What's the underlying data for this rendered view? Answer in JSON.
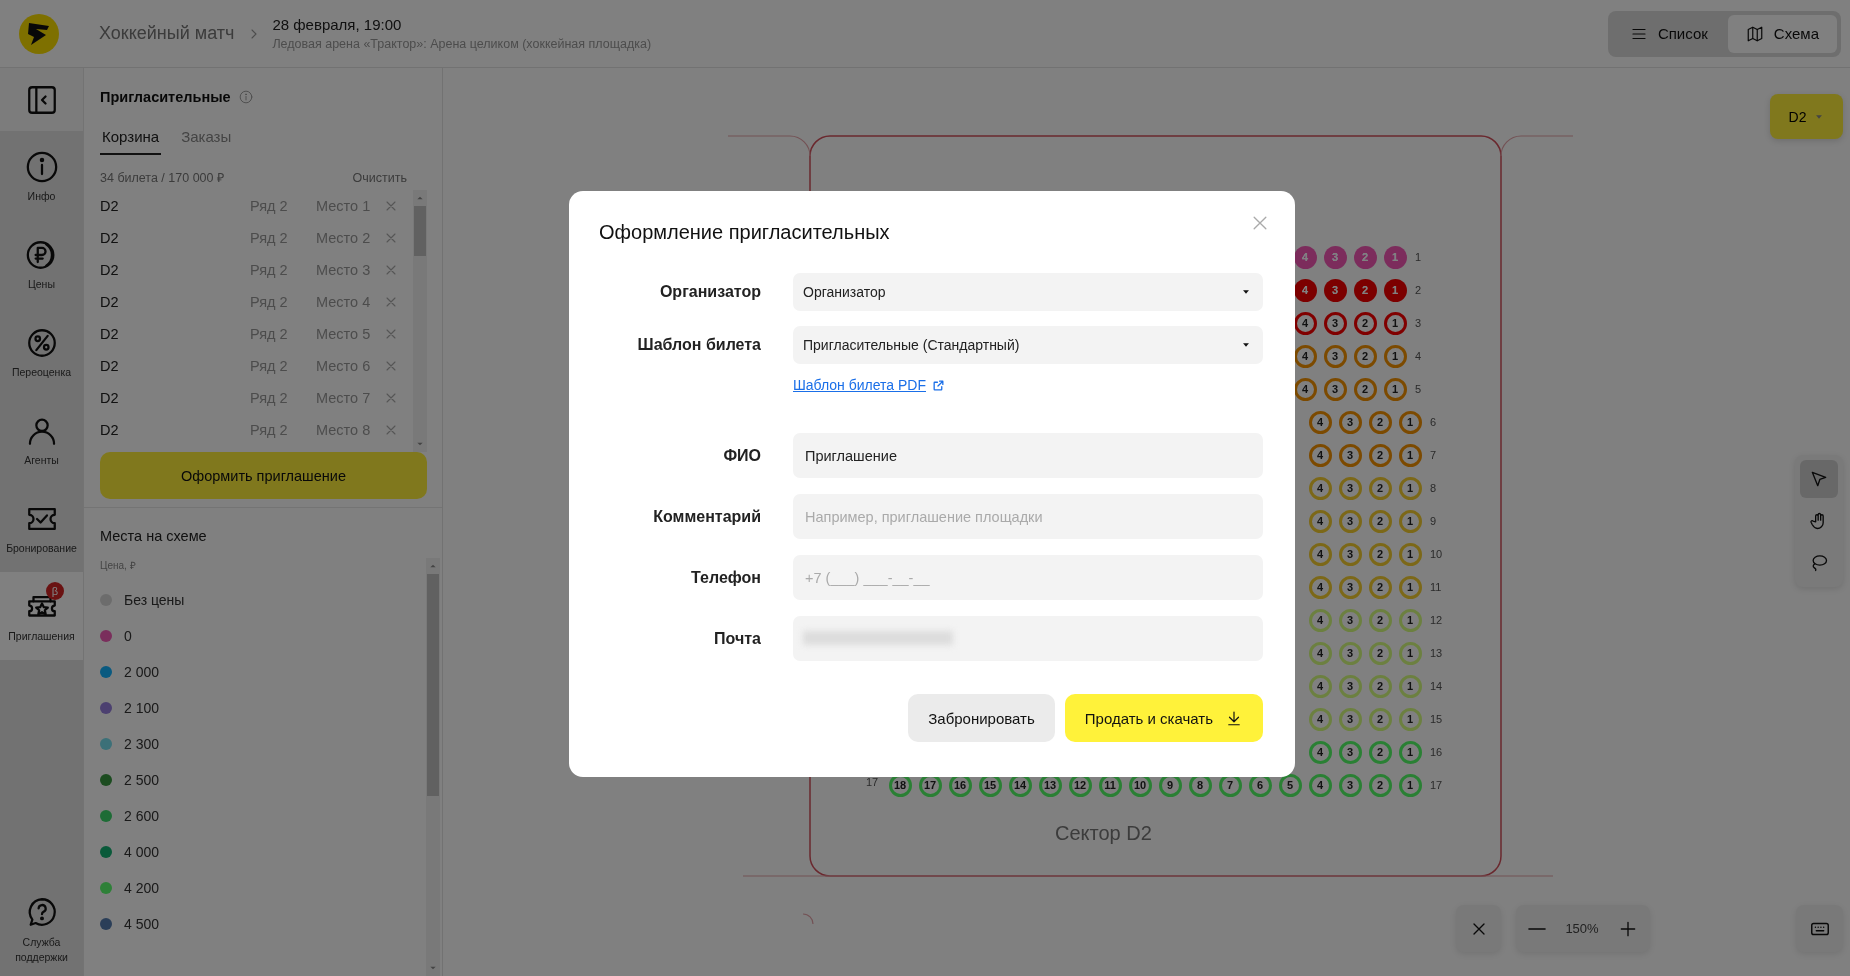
{
  "header": {
    "title": "Хоккейный матч",
    "date": "28 февраля, 19:00",
    "venue": "Ледовая арена «Трактор»: Арена целиком (хоккейная площадка)",
    "view_toggle": [
      {
        "kind": "list",
        "label": "Список",
        "selected": false
      },
      {
        "kind": "map",
        "label": "Схема",
        "selected": true
      }
    ]
  },
  "rail": {
    "items": [
      {
        "kind": "info",
        "label": "Инфо",
        "selected": false
      },
      {
        "kind": "prices",
        "label": "Цены",
        "selected": false
      },
      {
        "kind": "discount",
        "label": "Переоценка",
        "selected": false
      },
      {
        "kind": "agents",
        "label": "Агенты",
        "selected": false
      },
      {
        "kind": "booking",
        "label": "Бронирование",
        "selected": false
      },
      {
        "kind": "invites",
        "label": "Приглашения",
        "selected": true,
        "badge": "β"
      }
    ],
    "support": {
      "label": "Служба поддержки"
    }
  },
  "cart": {
    "title": "Пригласительные",
    "tabs": [
      {
        "label": "Корзина",
        "selected": true
      },
      {
        "label": "Заказы",
        "selected": false
      }
    ],
    "summary": "34 билета / 170 000 ₽",
    "clear": "Очистить",
    "items": [
      {
        "sector": "D2",
        "row": "Ряд 2",
        "seat": "Место 1"
      },
      {
        "sector": "D2",
        "row": "Ряд 2",
        "seat": "Место 2"
      },
      {
        "sector": "D2",
        "row": "Ряд 2",
        "seat": "Место 3"
      },
      {
        "sector": "D2",
        "row": "Ряд 2",
        "seat": "Место 4"
      },
      {
        "sector": "D2",
        "row": "Ряд 2",
        "seat": "Место 5"
      },
      {
        "sector": "D2",
        "row": "Ряд 2",
        "seat": "Место 6"
      },
      {
        "sector": "D2",
        "row": "Ряд 2",
        "seat": "Место 7"
      },
      {
        "sector": "D2",
        "row": "Ряд 2",
        "seat": "Место 8"
      }
    ],
    "button": "Оформить приглашение"
  },
  "legend": {
    "title": "Места на схеме",
    "caption": "Цена, ₽",
    "items": [
      {
        "label": "Без цены",
        "color": "#6c6c6c"
      },
      {
        "label": "0",
        "color": "#7a2e5c"
      },
      {
        "label": "2 000",
        "color": "#0a5a8a"
      },
      {
        "label": "2 100",
        "color": "#4c4070"
      },
      {
        "label": "2 300",
        "color": "#3c7078"
      },
      {
        "label": "2 500",
        "color": "#1c4c20"
      },
      {
        "label": "2 600",
        "color": "#1e6c36"
      },
      {
        "label": "4 000",
        "color": "#0a5a3a"
      },
      {
        "label": "4 200",
        "color": "#2e8038"
      },
      {
        "label": "4 500",
        "color": "#2a3e58"
      }
    ]
  },
  "seat_map": {
    "sector": "Сектор D2",
    "rows": [
      {
        "label": "1",
        "color": "#7c2c5c",
        "filled": true,
        "seats": [
          "4",
          "3",
          "2",
          "1"
        ]
      },
      {
        "label": "2",
        "color": "#7c0000",
        "filled": true,
        "seats": [
          "4",
          "3",
          "2",
          "1"
        ]
      },
      {
        "label": "3",
        "color": "#8c0000",
        "filled": false,
        "seats": [
          "4",
          "3",
          "2",
          "1"
        ]
      },
      {
        "label": "4",
        "color": "#7c4a00",
        "filled": false,
        "seats": [
          "4",
          "3",
          "2",
          "1"
        ]
      },
      {
        "label": "5",
        "color": "#7c4a00",
        "filled": false,
        "seats": [
          "4",
          "3",
          "2",
          "1"
        ]
      },
      {
        "label": "6",
        "color": "#7c4a00",
        "filled": false,
        "seats": [
          "4",
          "3",
          "2",
          "1"
        ]
      },
      {
        "label": "7",
        "color": "#7c4a00",
        "filled": false,
        "seats": [
          "4",
          "3",
          "2",
          "1"
        ]
      },
      {
        "label": "8",
        "color": "#7c6818",
        "filled": false,
        "seats": [
          "4",
          "3",
          "2",
          "1"
        ]
      },
      {
        "label": "9",
        "color": "#7c6818",
        "filled": false,
        "seats": [
          "4",
          "3",
          "2",
          "1"
        ]
      },
      {
        "label": "10",
        "color": "#7c6818",
        "filled": false,
        "seats": [
          "4",
          "3",
          "2",
          "1"
        ]
      },
      {
        "label": "11",
        "color": "#7c6818",
        "filled": false,
        "seats": [
          "4",
          "3",
          "2",
          "1"
        ]
      },
      {
        "label": "12",
        "color": "#6c8c40",
        "filled": false,
        "seats": [
          "4",
          "3",
          "2",
          "1"
        ]
      },
      {
        "label": "13",
        "color": "#6c8c40",
        "filled": false,
        "seats": [
          "4",
          "3",
          "2",
          "1"
        ]
      },
      {
        "label": "14",
        "color": "#6c8c40",
        "filled": false,
        "seats": [
          "4",
          "3",
          "2",
          "1"
        ]
      },
      {
        "label": "15",
        "color": "#6c8c40",
        "filled": false,
        "seats": [
          "4",
          "3",
          "2",
          "1"
        ]
      },
      {
        "label": "16",
        "color": "#2a8a34",
        "filled": false,
        "seats": [
          "4",
          "3",
          "2",
          "1"
        ]
      },
      {
        "label": "17",
        "left_label": "17",
        "color": "#2a8a34",
        "filled": false,
        "seats": [
          "18",
          "17",
          "16",
          "15",
          "14",
          "13",
          "12",
          "11",
          "10",
          "9",
          "8",
          "7",
          "6",
          "5",
          "4",
          "3",
          "2",
          "1"
        ]
      }
    ]
  },
  "map_controls": {
    "sector_select": "D2",
    "tools": [
      {
        "kind": "pointer",
        "selected": true
      },
      {
        "kind": "hand",
        "selected": false
      },
      {
        "kind": "lasso",
        "selected": false
      }
    ],
    "zoom": "150%"
  },
  "modal": {
    "title": "Оформление пригласительных",
    "fields": [
      {
        "kind": "select",
        "label": "Организатор",
        "value": "Организатор"
      },
      {
        "kind": "select",
        "label": "Шаблон билета",
        "value": "Пригласительные (Стандартный)",
        "link": "Шаблон билета PDF"
      },
      {
        "kind": "text",
        "label": "ФИО",
        "value": "Приглашение"
      },
      {
        "kind": "text",
        "label": "Комментарий",
        "placeholder": "Например, приглашение площадки"
      },
      {
        "kind": "text",
        "label": "Телефон",
        "placeholder": "+7 (___) ___-__-__"
      },
      {
        "kind": "text",
        "label": "Почта",
        "redacted": true
      }
    ],
    "buttons": [
      {
        "kind": "secondary",
        "label": "Забронировать"
      },
      {
        "kind": "primary",
        "label": "Продать и скачать"
      }
    ]
  }
}
